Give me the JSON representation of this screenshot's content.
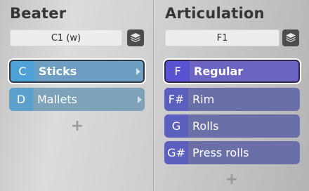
{
  "beater": {
    "title": "Beater",
    "slot_value": "C1 (w)",
    "layers_icon": "layers-icon",
    "items": [
      {
        "key": "C",
        "label": "Sticks",
        "selected": true
      },
      {
        "key": "D",
        "label": "Mallets",
        "selected": false
      }
    ],
    "add_label": "+"
  },
  "articulation": {
    "title": "Articulation",
    "slot_value": "F1",
    "layers_icon": "layers-icon",
    "items": [
      {
        "key": "F",
        "label": "Regular",
        "selected": true
      },
      {
        "key": "F#",
        "label": "Rim",
        "selected": false
      },
      {
        "key": "G",
        "label": "Rolls",
        "selected": false
      },
      {
        "key": "G#",
        "label": "Press rolls",
        "selected": false
      }
    ],
    "add_label": "+"
  },
  "colors": {
    "beater_item": "#7ea3b9",
    "beater_key": "#5ba1cb",
    "articulation_item": "#6a6fa8",
    "articulation_key": "#5b5fbe",
    "selection_outline": "#ffffff"
  }
}
